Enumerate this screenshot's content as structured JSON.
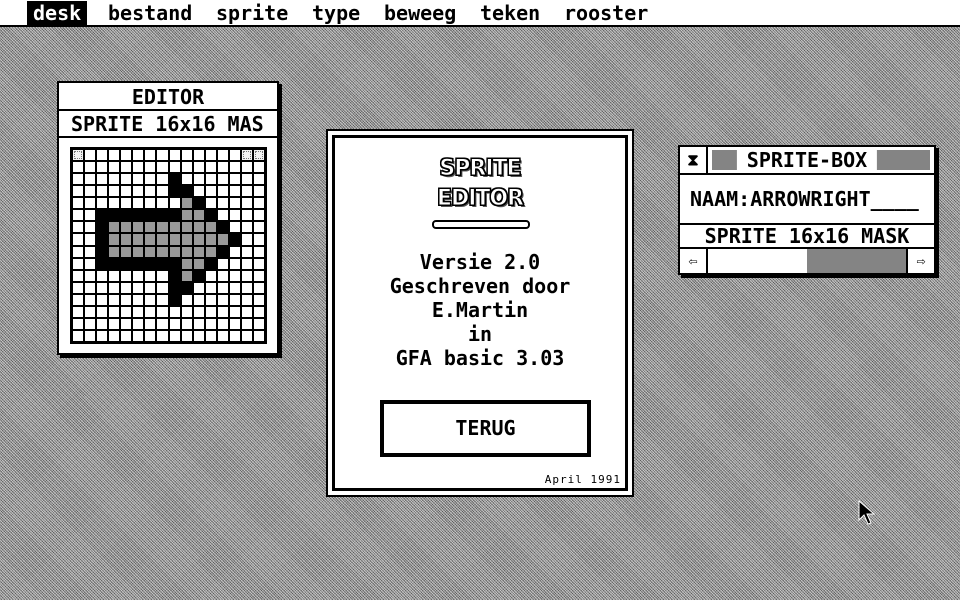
{
  "menubar": {
    "items": [
      {
        "label": "desk",
        "active": true
      },
      {
        "label": "bestand",
        "active": false
      },
      {
        "label": "sprite",
        "active": false
      },
      {
        "label": "type",
        "active": false
      },
      {
        "label": "beweeg",
        "active": false
      },
      {
        "label": "teken",
        "active": false
      },
      {
        "label": "rooster",
        "active": false
      }
    ]
  },
  "editor": {
    "title": "EDITOR",
    "info": "SPRITE  16x16 MAS",
    "grid": {
      "size": 16,
      "legend": {
        "b": "pixel-set",
        "g": "mask",
        "m": "marker",
        ".": "empty"
      },
      "rows": [
        "m.............mm",
        "................",
        "........b.......",
        "........bb......",
        ".........gb.....",
        "..bbbbbbbggb....",
        "..bgggggggggb...",
        "..bggggggggggb..",
        "..bgggggggggb...",
        "..bbbbbbbggb....",
        "........bgb.....",
        "........bb......",
        "........b.......",
        "................",
        "................",
        "................"
      ]
    }
  },
  "about_dialog": {
    "logo_line1": "SPRITE",
    "logo_line2": "EDITOR",
    "lines": [
      "Versie 2.0",
      "Geschreven door",
      "E.Martin",
      "in",
      "GFA basic 3.03"
    ],
    "button_label": "TERUG",
    "date": "April 1991"
  },
  "sprite_box": {
    "title": "SPRITE-BOX",
    "close_icon": "close-box-icon",
    "name_field": "NAAM:ARROWRIGHT____",
    "info": "SPRITE  16x16 MASK",
    "scroll_left_icon": "arrow-left-icon",
    "scroll_right_icon": "arrow-right-icon",
    "scroll_position": 0.5
  },
  "pointer": {
    "icon": "mouse-pointer-icon"
  }
}
